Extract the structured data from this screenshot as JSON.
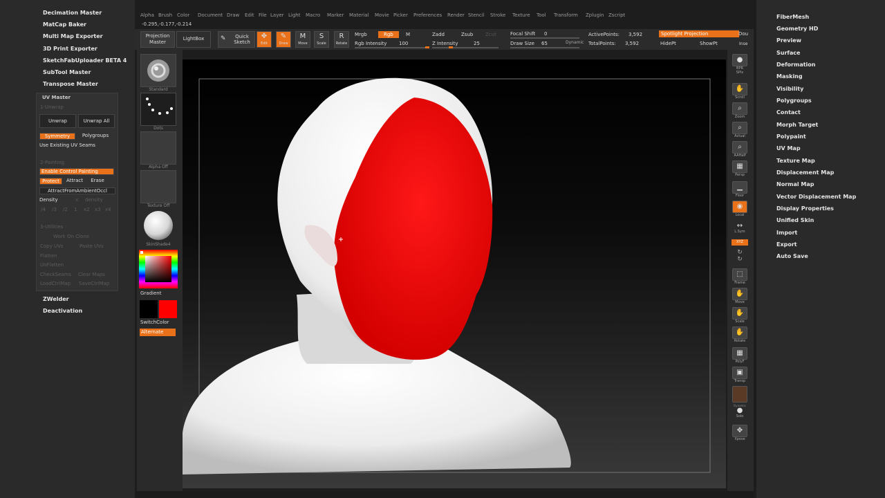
{
  "left_panel": {
    "plugins_top": [
      "Decimation Master",
      "MatCap Baker",
      "Multi Map Exporter",
      "3D Print Exporter",
      "SketchFabUploader BETA 4",
      "SubTool Master",
      "Transpose Master"
    ],
    "uv_master": {
      "title": "UV Master",
      "section1": "1-Unwrap",
      "unwrap": "Unwrap",
      "unwrap_all": "Unwrap All",
      "symmetry": "Symmetry",
      "polygroups": "Polygroups",
      "use_existing": "Use Existing UV Seams",
      "section2": "2-Painting",
      "enable_control_painting": "Enable Control Painting",
      "protect": "Protect",
      "attract": "Attract",
      "erase": "Erase",
      "attract_ambient": "AttractFromAmbientOccl",
      "density": "Density",
      "density_value": "x",
      "density_slider": "density",
      "density_steps": [
        "/4",
        "/3",
        "/2",
        "1",
        "x2",
        "x3",
        "x4"
      ],
      "section3": "3-Utilities",
      "work_on_clone": "Work On Clone",
      "copy_uvs": "Copy UVs",
      "paste_uvs": "Paste UVs",
      "flatten": "Flatten",
      "unflatten": "UnFlatten",
      "check_seams": "CheckSeams",
      "clear_maps": "Clear Maps",
      "load_ctrl_map": "LoadCtrlMap",
      "save_ctrl_map": "SaveCtrlMap"
    },
    "plugins_bottom": [
      "ZWelder",
      "Deactivation"
    ]
  },
  "menu": [
    "Alpha",
    "Brush",
    "Color",
    "Document",
    "Draw",
    "Edit",
    "File",
    "Layer",
    "Light",
    "Macro",
    "Marker",
    "Material",
    "Movie",
    "Picker",
    "Preferences",
    "Render",
    "Stencil",
    "Stroke",
    "Texture",
    "Tool",
    "Transform",
    "Zplugin",
    "Zscript"
  ],
  "coords": "-0.295,-0.177,-0.214",
  "toolbar": {
    "projection_master": "Projection Master",
    "lightbox": "LightBox",
    "quick_sketch": "Quick Sketch",
    "edit": "Edit",
    "draw": "Draw",
    "move": "Move",
    "scale": "Scale",
    "rotate": "Rotate",
    "mrgb": "Mrgb",
    "rgb": "Rgb",
    "m": "M",
    "rgb_intensity_label": "Rgb Intensity",
    "rgb_intensity": "100",
    "rgb_intensity_frac": 1.0,
    "zadd": "Zadd",
    "zsub": "Zsub",
    "zcut": "Zcut",
    "z_intensity_label": "Z Intensity",
    "z_intensity": "25",
    "z_intensity_frac": 0.25,
    "focal_shift_label": "Focal Shift",
    "focal_shift": "0",
    "draw_size_label": "Draw Size",
    "draw_size": "65",
    "dynamic": "Dynamic",
    "active_points_label": "ActivePoints:",
    "active_points": "3,592",
    "total_points_label": "TotalPoints:",
    "total_points": "3,592",
    "spotlight": "Spotlight Projection",
    "dou": "Dou",
    "hidept": "HidePt",
    "showpt": "ShowPt",
    "ins": "Inse"
  },
  "tray": {
    "brush": "Standard",
    "stroke": "Dots",
    "alpha": "Alpha Off",
    "texture": "Texture Off",
    "material": "SkinShade4",
    "gradient": "Gradient",
    "switch_color": "SwitchColor",
    "alternate": "Alternate",
    "main_color": "#000000",
    "secondary_color": "#ff0000",
    "accent": "#e8711a"
  },
  "shelf": [
    "BPR",
    "SPix",
    "Scroll",
    "Zoom",
    "Actual",
    "AAHalf",
    "Persp",
    "Floor",
    "Local",
    "L.Sym",
    "XYZ",
    "",
    "",
    "Frame",
    "Move",
    "Scale",
    "Rotate",
    "PolyF",
    "Transp",
    "",
    "Dynamic",
    "Solo",
    "Xpose"
  ],
  "right_panel": [
    "FiberMesh",
    "Geometry HD",
    "Preview",
    "Surface",
    "Deformation",
    "Masking",
    "Visibility",
    "Polygroups",
    "Contact",
    "Morph Target",
    "Polypaint",
    "UV Map",
    "Texture Map",
    "Displacement Map",
    "Normal Map",
    "Vector Displacement Map",
    "Display Properties",
    "Unified Skin",
    "Import",
    "Export",
    "Auto Save"
  ]
}
